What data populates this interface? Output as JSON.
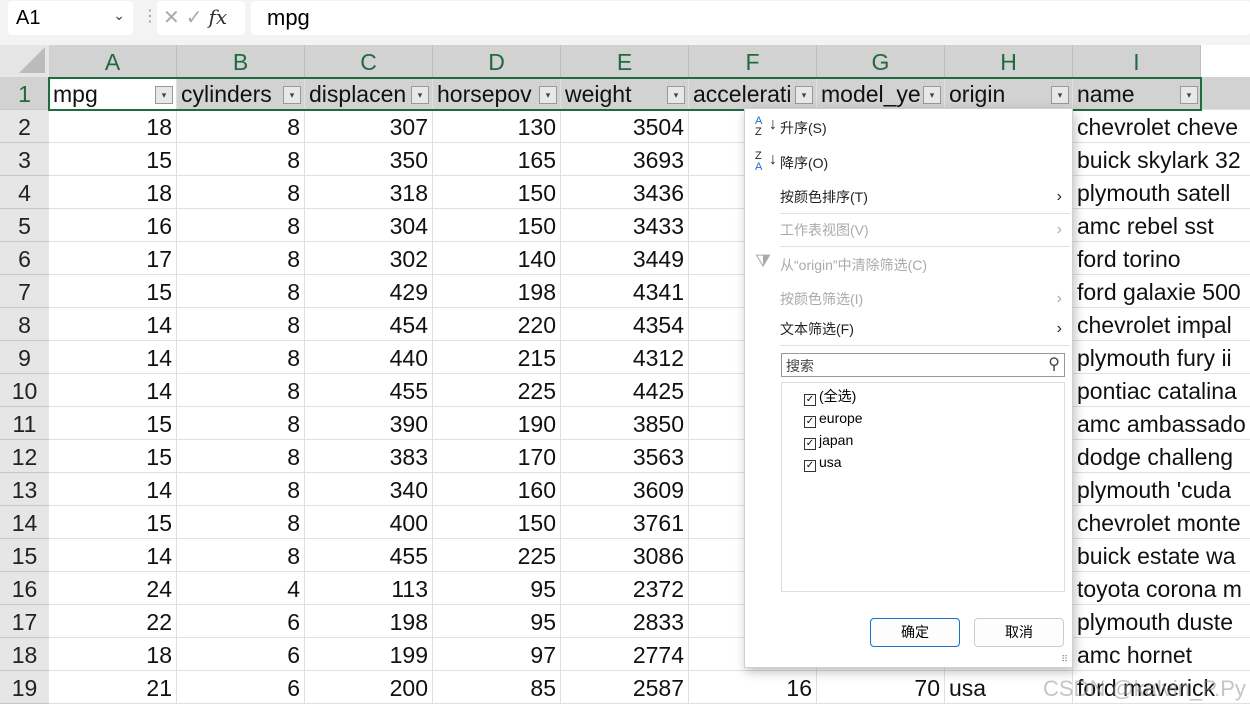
{
  "formula_bar": {
    "name_box": "A1",
    "formula": "mpg",
    "fx_label": "fx"
  },
  "columns": [
    "A",
    "B",
    "C",
    "D",
    "E",
    "F",
    "G",
    "H",
    "I"
  ],
  "headers": [
    "mpg",
    "cylinders",
    "displacen",
    "horsepov",
    "weight",
    "accelerati",
    "model_ye",
    "origin",
    "name"
  ],
  "rows": [
    {
      "n": "1"
    },
    {
      "n": "2",
      "v": [
        "18",
        "8",
        "307",
        "130",
        "3504",
        "",
        "",
        "",
        "chevrolet cheve"
      ]
    },
    {
      "n": "3",
      "v": [
        "15",
        "8",
        "350",
        "165",
        "3693",
        "",
        "",
        "",
        "buick skylark 32"
      ]
    },
    {
      "n": "4",
      "v": [
        "18",
        "8",
        "318",
        "150",
        "3436",
        "",
        "",
        "",
        "plymouth satell"
      ]
    },
    {
      "n": "5",
      "v": [
        "16",
        "8",
        "304",
        "150",
        "3433",
        "",
        "",
        "",
        "amc rebel sst"
      ]
    },
    {
      "n": "6",
      "v": [
        "17",
        "8",
        "302",
        "140",
        "3449",
        "",
        "",
        "",
        "ford torino"
      ]
    },
    {
      "n": "7",
      "v": [
        "15",
        "8",
        "429",
        "198",
        "4341",
        "",
        "",
        "",
        "ford galaxie 500"
      ]
    },
    {
      "n": "8",
      "v": [
        "14",
        "8",
        "454",
        "220",
        "4354",
        "",
        "",
        "",
        "chevrolet impal"
      ]
    },
    {
      "n": "9",
      "v": [
        "14",
        "8",
        "440",
        "215",
        "4312",
        "",
        "",
        "",
        "plymouth fury ii"
      ]
    },
    {
      "n": "10",
      "v": [
        "14",
        "8",
        "455",
        "225",
        "4425",
        "",
        "",
        "",
        "pontiac catalina"
      ]
    },
    {
      "n": "11",
      "v": [
        "15",
        "8",
        "390",
        "190",
        "3850",
        "",
        "",
        "",
        "amc ambassado"
      ]
    },
    {
      "n": "12",
      "v": [
        "15",
        "8",
        "383",
        "170",
        "3563",
        "",
        "",
        "",
        "dodge challeng"
      ]
    },
    {
      "n": "13",
      "v": [
        "14",
        "8",
        "340",
        "160",
        "3609",
        "",
        "",
        "",
        "plymouth 'cuda"
      ]
    },
    {
      "n": "14",
      "v": [
        "15",
        "8",
        "400",
        "150",
        "3761",
        "",
        "",
        "",
        "chevrolet monte"
      ]
    },
    {
      "n": "15",
      "v": [
        "14",
        "8",
        "455",
        "225",
        "3086",
        "",
        "",
        "",
        "buick estate wa"
      ]
    },
    {
      "n": "16",
      "v": [
        "24",
        "4",
        "113",
        "95",
        "2372",
        "",
        "",
        "",
        "toyota corona m"
      ]
    },
    {
      "n": "17",
      "v": [
        "22",
        "6",
        "198",
        "95",
        "2833",
        "",
        "",
        "",
        "plymouth duste"
      ]
    },
    {
      "n": "18",
      "v": [
        "18",
        "6",
        "199",
        "97",
        "2774",
        "",
        "",
        "",
        "amc hornet"
      ]
    },
    {
      "n": "19",
      "v": [
        "21",
        "6",
        "200",
        "85",
        "2587",
        "16",
        "70",
        "usa",
        "ford maverick"
      ]
    }
  ],
  "filter_menu": {
    "sort_asc": "升序(S)",
    "sort_desc": "降序(O)",
    "sort_by_color": "按颜色排序(T)",
    "sheet_view": "工作表视图(V)",
    "clear_filter": "从“origin”中清除筛选(C)",
    "filter_by_color": "按颜色筛选(I)",
    "text_filter": "文本筛选(F)",
    "search_placeholder": "搜索",
    "items": [
      {
        "label": "(全选)",
        "checked": true
      },
      {
        "label": "europe",
        "checked": true
      },
      {
        "label": "japan",
        "checked": true
      },
      {
        "label": "usa",
        "checked": true
      }
    ],
    "ok": "确定",
    "cancel": "取消"
  },
  "watermark": "CSDN @kalvin_P.Py",
  "colors": {
    "accent": "#1e6b3f",
    "button_focus": "#1a6fc9"
  }
}
